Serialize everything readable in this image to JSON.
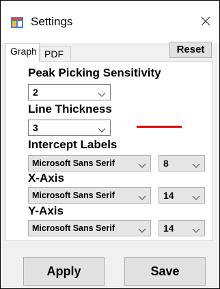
{
  "window": {
    "title": "Settings",
    "icon": "settings-app-icon",
    "close_icon": "close-icon"
  },
  "tabs": [
    {
      "label": "Graph",
      "selected": true
    },
    {
      "label": "PDF",
      "selected": false
    }
  ],
  "reset_label": "Reset",
  "graph": {
    "peak_picking": {
      "label": "Peak Picking Sensitivity",
      "value": "2"
    },
    "line_thickness": {
      "label": "Line Thickness",
      "value": "3",
      "line_color": "#e00000"
    },
    "intercept_labels": {
      "label": "Intercept Labels",
      "font": "Microsoft Sans Serif",
      "size": "8"
    },
    "x_axis": {
      "label": "X-Axis",
      "font": "Microsoft Sans Serif",
      "size": "14"
    },
    "y_axis": {
      "label": "Y-Axis",
      "font": "Microsoft Sans Serif",
      "size": "14"
    }
  },
  "buttons": {
    "apply": "Apply",
    "save": "Save"
  }
}
